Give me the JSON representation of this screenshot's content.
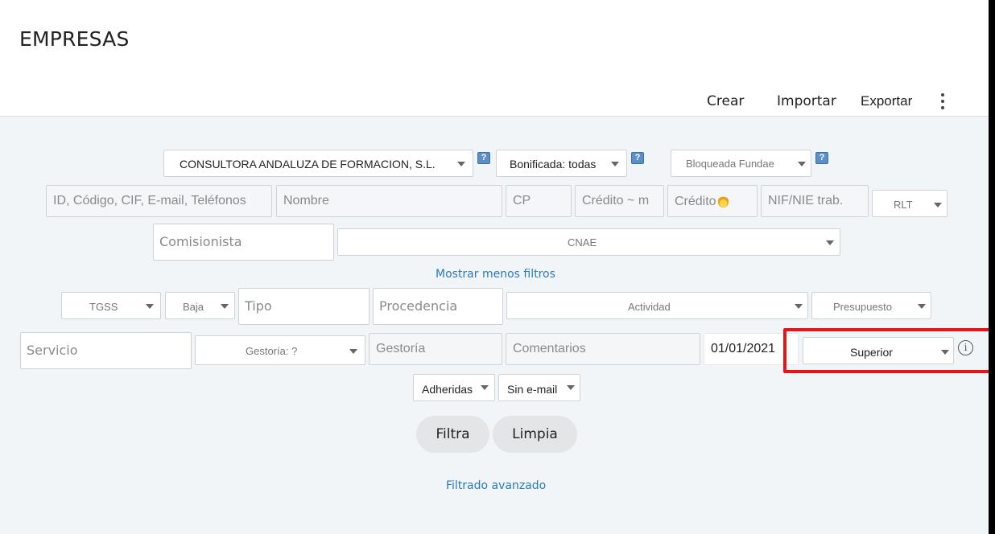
{
  "header": {
    "title": "EMPRESAS",
    "nav": {
      "crear": "Crear",
      "importar": "Importar",
      "exportar": "Exportar"
    }
  },
  "filters": {
    "row1": {
      "company": "CONSULTORA ANDALUZA DE FORMACION, S.L.",
      "bonificada": "Bonificada: todas",
      "bloqueada": "Bloqueada Fundae",
      "help": "?"
    },
    "row2": {
      "search_placeholder": "ID, Código, CIF, E-mail, Teléfonos",
      "nombre_placeholder": "Nombre",
      "cp_placeholder": "CP",
      "credito_m_placeholder": "Crédito ~ m",
      "credito_placeholder": "Crédito",
      "nif_placeholder": "NIF/NIE trab.",
      "rlt": "RLT"
    },
    "row3": {
      "comisionista_placeholder": "Comisionista",
      "cnae": "CNAE"
    },
    "toggle_link": "Mostrar menos filtros",
    "row4": {
      "tgss": "TGSS",
      "baja": "Baja",
      "tipo_placeholder": "Tipo",
      "procedencia_placeholder": "Procedencia",
      "actividad": "Actividad",
      "presupuesto": "Presupuesto"
    },
    "row5": {
      "servicio_placeholder": "Servicio",
      "gestoria_select": "Gestoría: ?",
      "gestoria_placeholder": "Gestoría",
      "comentarios_placeholder": "Comentarios",
      "date": "01/01/2021",
      "superior": "Superior",
      "info": "i"
    },
    "row6": {
      "adheridas": "Adheridas",
      "sin_email": "Sin e-mail"
    },
    "buttons": {
      "filtra": "Filtra",
      "limpia": "Limpia"
    },
    "advanced_link": "Filtrado avanzado"
  },
  "colors": {
    "link": "#2a7ab8",
    "highlight": "#e4161b",
    "panel_bg": "#f2f5f8"
  }
}
